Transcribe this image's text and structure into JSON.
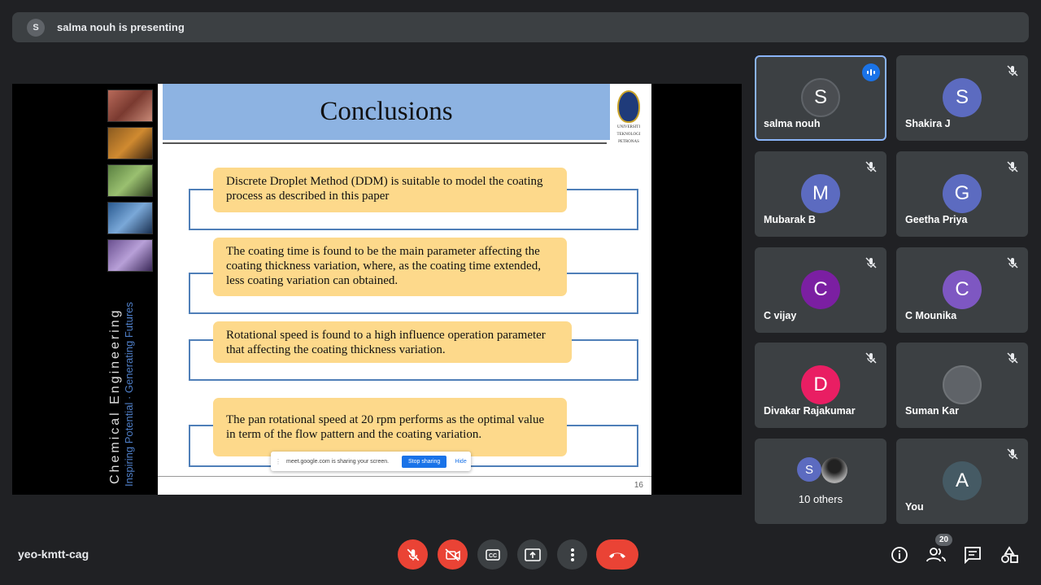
{
  "banner": {
    "avatar": "S",
    "text": "salma nouh is presenting"
  },
  "slide": {
    "title": "Conclusions",
    "side_text_line1": "Chemical Engineering",
    "side_text_line2": "Inspiring Potential · Generating Futures",
    "logo_text_1": "UNIVERSITI",
    "logo_text_2": "TEKNOLOGI",
    "logo_text_3": "PETRONAS",
    "points": [
      "Discrete Droplet Method (DDM) is suitable to model the coating process as described in this paper",
      "The coating time is found to be the main parameter affecting the coating thickness variation, where, as the coating time extended, less coating variation can obtained.",
      "Rotational speed is found to a high influence operation parameter that affecting the coating thickness variation.",
      "The pan rotational speed at 20 rpm performs as the optimal value in term of the flow pattern and the coating variation."
    ],
    "page_number": "16"
  },
  "share_popup": {
    "message": "meet.google.com is sharing your screen.",
    "stop_label": "Stop sharing",
    "hide_label": "Hide"
  },
  "participants": [
    {
      "name": "salma nouh",
      "initial": "S",
      "color": "#4a4d51",
      "speaking": true
    },
    {
      "name": "Shakira J",
      "initial": "S",
      "color": "#5c6bc0",
      "muted": true
    },
    {
      "name": "Mubarak B",
      "initial": "M",
      "color": "#5c6bc0",
      "muted": true
    },
    {
      "name": "Geetha Priya",
      "initial": "G",
      "color": "#5c6bc0",
      "muted": true
    },
    {
      "name": "C vijay",
      "initial": "C",
      "color": "#7b1fa2",
      "muted": true
    },
    {
      "name": "C Mounika",
      "initial": "C",
      "color": "#7e57c2",
      "muted": true
    },
    {
      "name": "Divakar Rajakumar",
      "initial": "D",
      "color": "#e91e63",
      "muted": true
    },
    {
      "name": "Suman Kar",
      "initial": "",
      "color": "#5f6368",
      "muted": true
    },
    {
      "name": "10 others",
      "initial": "S",
      "color": "#5c6bc0"
    },
    {
      "name": "You",
      "initial": "A",
      "color": "#455a64",
      "muted": true
    }
  ],
  "bottom": {
    "meeting_code": "yeo-kmtt-cag",
    "participant_count": "20"
  },
  "colors": {
    "end_call": "#ea4335",
    "accent": "#8ab4f8"
  }
}
